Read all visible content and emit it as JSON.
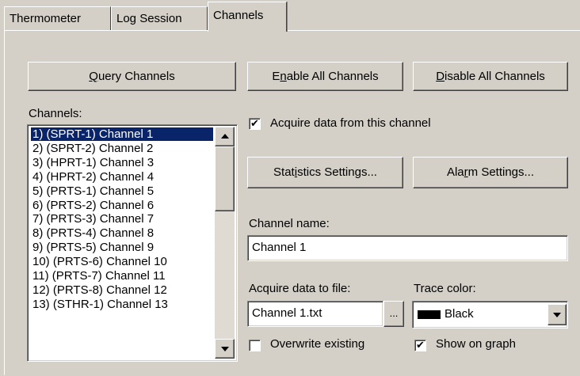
{
  "tabs": [
    {
      "label": "Thermometer"
    },
    {
      "label": "Log Session"
    },
    {
      "label": "Channels"
    }
  ],
  "buttons": {
    "query": {
      "pre": "",
      "mn": "Q",
      "post": "uery Channels"
    },
    "enable_all": {
      "pre": "E",
      "mn": "n",
      "post": "able All Channels"
    },
    "disable_all": {
      "pre": "",
      "mn": "D",
      "post": "isable All Channels"
    },
    "statistics": {
      "pre": "Stat",
      "mn": "i",
      "post": "stics Settings..."
    },
    "alarm": {
      "pre": "Ala",
      "mn": "r",
      "post": "m Settings..."
    },
    "browse": "..."
  },
  "channels_label": "Channels:",
  "channels": [
    "1)  (SPRT-1) Channel 1",
    "2)  (SPRT-2) Channel 2",
    "3)  (HPRT-1) Channel 3",
    "4)  (HPRT-2) Channel 4",
    "5)  (PRTS-1) Channel 5",
    "6)  (PRTS-2) Channel 6",
    "7)  (PRTS-3) Channel 7",
    "8)  (PRTS-4) Channel 8",
    "9)  (PRTS-5) Channel 9",
    "10)  (PRTS-6) Channel 10",
    "11)  (PRTS-7) Channel 11",
    "12)  (PRTS-8) Channel 12",
    "13)  (STHR-1) Channel 13"
  ],
  "acquire_checkbox": {
    "label": "Acquire data from this channel",
    "checked": true
  },
  "channel_name": {
    "label": "Channel name:",
    "value": "Channel 1"
  },
  "acquire_file": {
    "label": "Acquire data to file:",
    "value": "Channel 1.txt"
  },
  "trace_color": {
    "label": "Trace color:",
    "value": "Black",
    "swatch": "#000000"
  },
  "overwrite": {
    "label": "Overwrite existing",
    "checked": false
  },
  "show_on_graph": {
    "label": "Show on graph",
    "checked": true
  }
}
